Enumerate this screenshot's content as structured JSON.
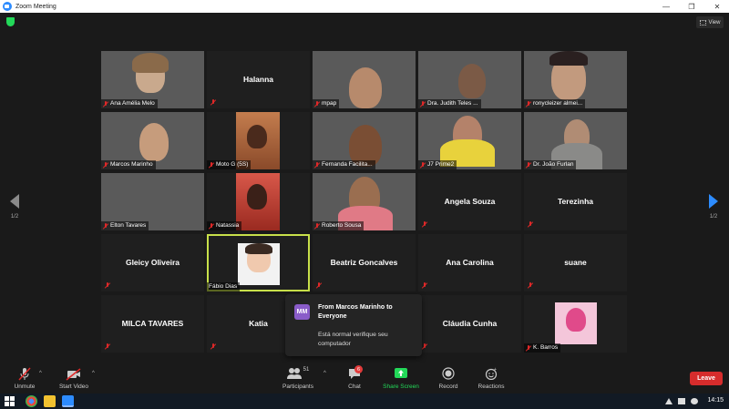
{
  "window": {
    "title": "Zoom Meeting",
    "minimize": "—",
    "maximize": "❐",
    "close": "✕"
  },
  "top": {
    "view_label": "View"
  },
  "pager": {
    "left": "1/2",
    "right": "1/2"
  },
  "participants": [
    "Ana Amélia Melo",
    "Halanna",
    "mpap",
    "Dra. Judith Teles ...",
    "ronycleizer almei...",
    "Marcos Marinho",
    "Moto G (5S)",
    "Fernanda Facilita...",
    "J7 Prime2",
    "Dr. João Furlan",
    "Elton Tavares",
    "Natassia",
    "Roberto Sousa",
    "Angela Souza",
    "Terezinha",
    "Gleicy Oliveira",
    "Fábio Dias",
    "Beatriz Goncalves",
    "Ana Carolina",
    "suane",
    "MILCA TAVARES",
    "Katia",
    "Cláudia Cunha",
    "K. Barros"
  ],
  "chat_popup": {
    "avatar": "MM",
    "from": "From Marcos Marinho to Everyone",
    "message": "Está normal verifique seu computador"
  },
  "toolbar": {
    "unmute": "Unmute",
    "start_video": "Start Video",
    "participants": "Participants",
    "participants_count": "51",
    "chat": "Chat",
    "chat_badge": "6",
    "share_screen": "Share Screen",
    "record": "Record",
    "reactions": "Reactions",
    "leave": "Leave"
  },
  "taskbar": {
    "clock": "14:15"
  },
  "colors": {
    "zoom_blue": "#2d8cff",
    "share_green": "#23d959",
    "leave_red": "#d62c2c",
    "active_speaker": "#c8e04a"
  }
}
